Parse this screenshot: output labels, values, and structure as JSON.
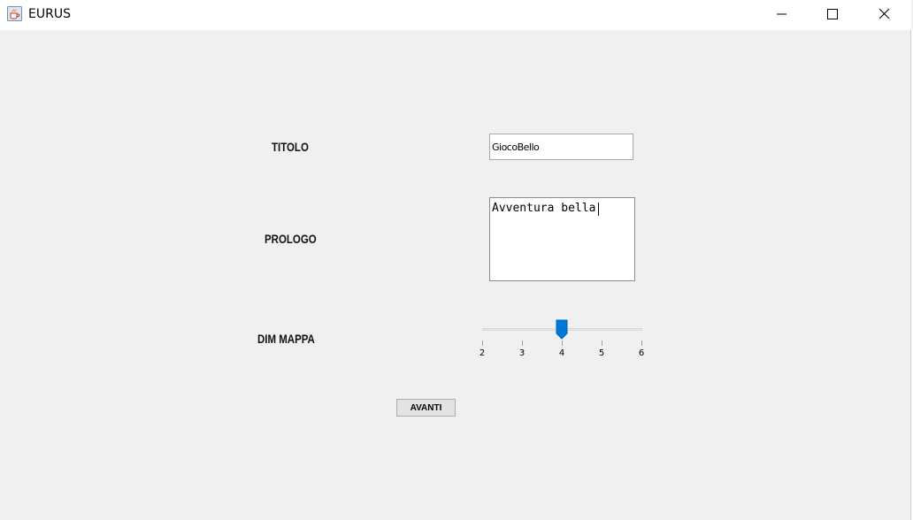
{
  "window": {
    "title": "EURUS",
    "icon": "java-coffee-cup-icon"
  },
  "form": {
    "titolo_label": "TITOLO",
    "titolo_value": "GiocoBello",
    "prologo_label": "PROLOGO",
    "prologo_value": "Avventura bella",
    "dim_mappa_label": "DIM MAPPA",
    "slider": {
      "min": 2,
      "max": 6,
      "value": 4,
      "ticks": [
        "2",
        "3",
        "4",
        "5",
        "6"
      ]
    },
    "avanti_label": "AVANTI"
  },
  "colors": {
    "accent": "#0078d7",
    "background": "#f0f0f0"
  }
}
